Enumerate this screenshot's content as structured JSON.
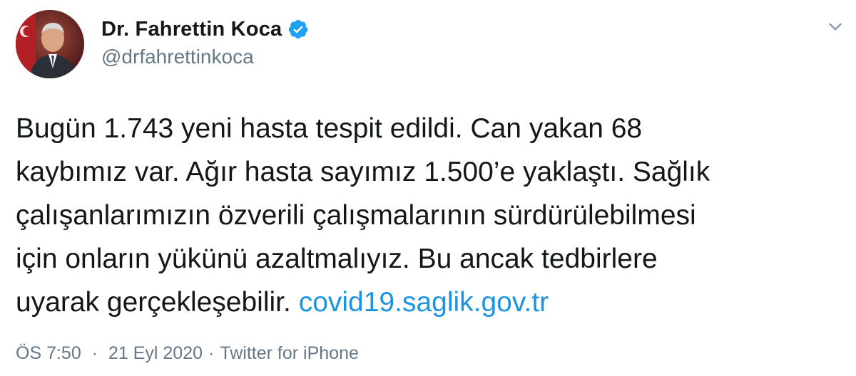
{
  "author": {
    "display_name": "Dr. Fahrettin Koca",
    "handle": "@drfahrettinkoca",
    "verified_icon": "verified-badge-icon"
  },
  "tweet": {
    "text_lines": [
      "Bugün 1.743 yeni hasta tespit edildi. Can yakan 68",
      "kaybımız var. Ağır hasta sayımız 1.500’e yaklaştı. Sağlık",
      "çalışanlarımızın özverili çalışmalarının sürdürülebilmesi",
      "için onların yükünü azaltmalıyız. Bu ancak tedbirlere",
      "uyarak gerçekleşebilir. "
    ],
    "link_text": "covid19.saglik.gov.tr"
  },
  "meta": {
    "time": "ÖS 7:50",
    "separator": "·",
    "date": "21 Eyl 2020",
    "source": "Twitter for iPhone"
  },
  "colors": {
    "link": "#1b95e0",
    "secondary_text": "#657786",
    "verified": "#1da1f2"
  },
  "icons": {
    "menu": "chevron-down-icon"
  }
}
